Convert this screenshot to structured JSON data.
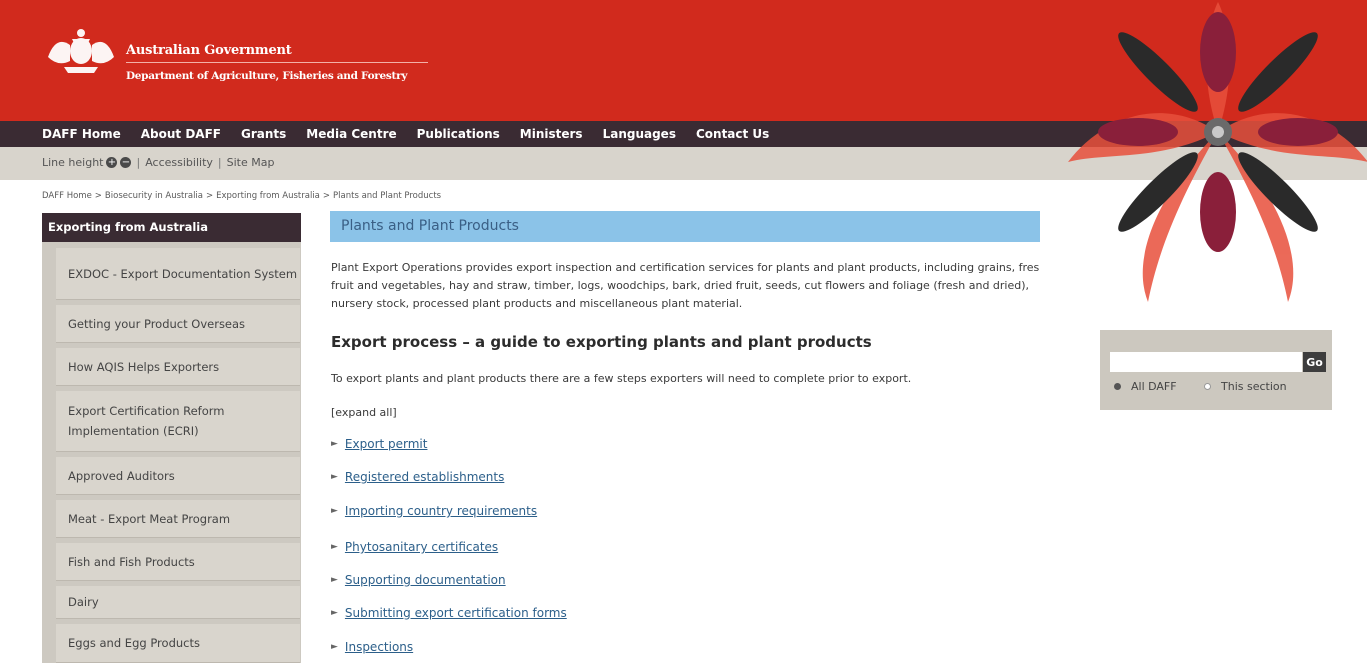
{
  "header": {
    "gov_title": "Australian Government",
    "dept_title": "Department of Agriculture, Fisheries and Forestry",
    "brand_color": "#d12a1d"
  },
  "nav": {
    "items": [
      "DAFF Home",
      "About DAFF",
      "Grants",
      "Media Centre",
      "Publications",
      "Ministers",
      "Languages",
      "Contact Us"
    ]
  },
  "util": {
    "line_height_label": "Line height",
    "increase_icon": "+",
    "decrease_icon": "−",
    "accessibility": "Accessibility",
    "site_map": "Site Map",
    "separator": "|"
  },
  "breadcrumb": {
    "items": [
      "DAFF Home",
      "Biosecurity in Australia",
      "Exporting from Australia",
      "Plants and Plant Products"
    ],
    "separator": ">"
  },
  "sidebar": {
    "title": "Exporting from Australia",
    "items": [
      {
        "label": "EXDOC - Export Documentation System"
      },
      {
        "label": "Getting your Product Overseas"
      },
      {
        "label": "How AQIS Helps Exporters"
      },
      {
        "label": "Export Certification Reform Implementation (ECRI)"
      },
      {
        "label": "Approved Auditors"
      },
      {
        "label": "Meat - Export Meat Program"
      },
      {
        "label": "Fish and Fish Products"
      },
      {
        "label": "Dairy"
      },
      {
        "label": "Eggs and Egg Products"
      }
    ]
  },
  "main": {
    "heading": "Plants and Plant Products",
    "intro": "Plant Export Operations provides export inspection and certification services for plants and plant products, including grains, fresh fruit and vegetables, hay and straw, timber, logs, woodchips, bark, dried fruit, seeds, cut flowers and foliage (fresh and dried), nursery stock, processed plant products and miscellaneous plant material.",
    "section_heading": "Export process – a guide to exporting plants and plant products",
    "section_intro": "To export plants and plant products there are a few steps exporters will need to complete prior to export.",
    "expand_all": "[expand all]",
    "accordion_arrow": "►",
    "accordion": [
      "Export permit",
      "Registered establishments",
      "Importing country requirements",
      "Phytosanitary certificates",
      "Supporting documentation",
      "Submitting export certification forms",
      "Inspections"
    ]
  },
  "search": {
    "value": "",
    "go_label": "Go",
    "options": [
      "All DAFF",
      "This section"
    ],
    "selected": "All DAFF"
  },
  "icons": {
    "crest": "coat-of-arms-icon",
    "art": "insect-mandala-artwork"
  }
}
